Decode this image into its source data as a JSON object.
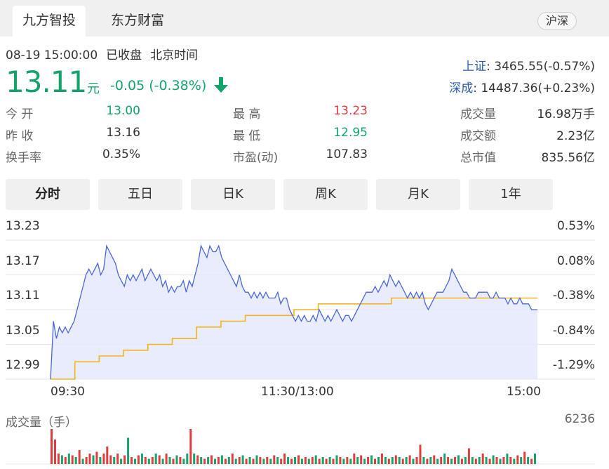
{
  "tabs": [
    {
      "label": "九方智投",
      "active": true
    },
    {
      "label": "东方财富",
      "active": false
    }
  ],
  "market_button": "沪深",
  "meta": {
    "datetime": "08-19 15:00:00",
    "status": "已收盘",
    "timezone": "北京时间"
  },
  "price": {
    "value": "13.11",
    "unit": "元",
    "change": "-0.05 (-0.38%)"
  },
  "indices": [
    {
      "name": "上证",
      "value": ": 3465.55(-0.57%)"
    },
    {
      "name": "深成",
      "value": ": 14487.36(+0.23%)"
    }
  ],
  "quote": {
    "open_label": "今 开",
    "open": "13.00",
    "prev_label": "昨 收",
    "prev": "13.16",
    "turnover_label": "换手率",
    "turnover": "0.35%",
    "high_label": "最 高",
    "high": "13.23",
    "low_label": "最 低",
    "low": "12.95",
    "pe_label": "市盈(动)",
    "pe": "107.83",
    "volume_label": "成交量",
    "volume": "16.98万手",
    "amount_label": "成交额",
    "amount": "2.23亿",
    "mcap_label": "总市值",
    "mcap": "835.56亿"
  },
  "period_tabs": [
    "分时",
    "五日",
    "日K",
    "周K",
    "月K",
    "1年"
  ],
  "active_period": 0,
  "colors": {
    "up": "#e23b3b",
    "down": "#14a36a",
    "price_line": "#4a66d6",
    "avg_line": "#f2b51d",
    "fill": "#e4e9fb"
  },
  "chart_data": {
    "type": "line",
    "y_price_ticks": [
      "13.23",
      "13.17",
      "13.11",
      "13.05",
      "12.99"
    ],
    "y_pct_ticks": [
      "0.53%",
      "0.08%",
      "-0.38%",
      "-0.84%",
      "-1.29%"
    ],
    "ylim": [
      12.99,
      13.23
    ],
    "x_tick_labels": [
      "09:30",
      "11:30/13:00",
      "15:00"
    ],
    "series": [
      {
        "role": "price",
        "values": [
          12.99,
          13.09,
          13.06,
          13.08,
          13.07,
          13.08,
          13.07,
          13.08,
          13.09,
          13.11,
          13.13,
          13.15,
          13.17,
          13.18,
          13.17,
          13.18,
          13.19,
          13.17,
          13.18,
          13.22,
          13.21,
          13.2,
          13.19,
          13.17,
          13.16,
          13.15,
          13.17,
          13.16,
          13.17,
          13.16,
          13.17,
          13.18,
          13.16,
          13.17,
          13.18,
          13.17,
          13.16,
          13.17,
          13.15,
          13.16,
          13.14,
          13.15,
          13.14,
          13.15,
          13.15,
          13.16,
          13.14,
          13.16,
          13.15,
          13.17,
          13.19,
          13.22,
          13.21,
          13.2,
          13.22,
          13.21,
          13.21,
          13.22,
          13.2,
          13.19,
          13.18,
          13.17,
          13.16,
          13.15,
          13.17,
          13.15,
          13.14,
          13.14,
          13.13,
          13.14,
          13.13,
          13.14,
          13.13,
          13.14,
          13.13,
          13.13,
          13.13,
          13.14,
          13.12,
          13.13,
          13.13,
          13.11,
          13.1,
          13.09,
          13.1,
          13.09,
          13.1,
          13.09,
          13.09,
          13.1,
          13.09,
          13.11,
          13.1,
          13.09,
          13.1,
          13.09,
          13.1,
          13.11,
          13.1,
          13.09,
          13.1,
          13.1,
          13.09,
          13.1,
          13.11,
          13.12,
          13.13,
          13.14,
          13.14,
          13.14,
          13.15,
          13.14,
          13.15,
          13.16,
          13.15,
          13.17,
          13.16,
          13.15,
          13.16,
          13.15,
          13.14,
          13.13,
          13.14,
          13.13,
          13.14,
          13.13,
          13.14,
          13.12,
          13.11,
          13.12,
          13.13,
          13.14,
          13.14,
          13.14,
          13.15,
          13.16,
          13.18,
          13.17,
          13.16,
          13.15,
          13.14,
          13.14,
          13.13,
          13.13,
          13.13,
          13.14,
          13.14,
          13.14,
          13.14,
          13.13,
          13.13,
          13.14,
          13.13,
          13.13,
          13.13,
          13.12,
          13.13,
          13.12,
          13.12,
          13.13,
          13.12,
          13.12,
          13.12,
          13.11,
          13.11,
          13.11
        ],
        "count": 240
      },
      {
        "role": "average",
        "values": [
          12.99,
          13.02,
          13.03,
          13.04,
          13.05,
          13.06,
          13.08,
          13.09,
          13.1,
          13.1,
          13.11,
          13.12,
          13.12,
          13.12,
          13.13,
          13.13,
          13.13,
          13.13,
          13.13,
          13.13,
          13.13
        ],
        "count": 240
      }
    ],
    "volume": {
      "ylabel": "成交量（手）",
      "max": 6236,
      "bars": [
        {
          "v": 1.0,
          "c": "up"
        },
        {
          "v": 0.7,
          "c": "up"
        },
        {
          "v": 0.3,
          "c": "up"
        },
        {
          "v": 0.25,
          "c": "down"
        },
        {
          "v": 0.2,
          "c": "up"
        },
        {
          "v": 0.3,
          "c": "down"
        },
        {
          "v": 0.25,
          "c": "up"
        },
        {
          "v": 0.2,
          "c": "down"
        },
        {
          "v": 0.4,
          "c": "up"
        },
        {
          "v": 0.15,
          "c": "down"
        },
        {
          "v": 0.2,
          "c": "up"
        },
        {
          "v": 0.3,
          "c": "up"
        },
        {
          "v": 0.25,
          "c": "down"
        },
        {
          "v": 0.35,
          "c": "up"
        },
        {
          "v": 0.2,
          "c": "down"
        },
        {
          "v": 0.3,
          "c": "up"
        },
        {
          "v": 0.5,
          "c": "up"
        },
        {
          "v": 0.25,
          "c": "up"
        },
        {
          "v": 0.2,
          "c": "down"
        },
        {
          "v": 0.3,
          "c": "up"
        },
        {
          "v": 0.15,
          "c": "down"
        },
        {
          "v": 0.25,
          "c": "up"
        },
        {
          "v": 0.75,
          "c": "down"
        },
        {
          "v": 0.2,
          "c": "up"
        },
        {
          "v": 0.15,
          "c": "down"
        },
        {
          "v": 0.25,
          "c": "up"
        },
        {
          "v": 0.3,
          "c": "down"
        },
        {
          "v": 0.2,
          "c": "up"
        },
        {
          "v": 0.15,
          "c": "down"
        },
        {
          "v": 0.2,
          "c": "up"
        },
        {
          "v": 0.3,
          "c": "down"
        },
        {
          "v": 0.25,
          "c": "up"
        },
        {
          "v": 0.15,
          "c": "down"
        },
        {
          "v": 0.3,
          "c": "up"
        },
        {
          "v": 0.2,
          "c": "down"
        },
        {
          "v": 0.15,
          "c": "up"
        },
        {
          "v": 0.25,
          "c": "down"
        },
        {
          "v": 0.2,
          "c": "up"
        },
        {
          "v": 0.15,
          "c": "down"
        },
        {
          "v": 0.3,
          "c": "down"
        },
        {
          "v": 1.0,
          "c": "up"
        },
        {
          "v": 0.3,
          "c": "down"
        },
        {
          "v": 0.25,
          "c": "up"
        },
        {
          "v": 0.2,
          "c": "down"
        },
        {
          "v": 0.15,
          "c": "up"
        },
        {
          "v": 0.2,
          "c": "down"
        },
        {
          "v": 0.25,
          "c": "up"
        },
        {
          "v": 0.15,
          "c": "down"
        },
        {
          "v": 0.2,
          "c": "up"
        },
        {
          "v": 0.25,
          "c": "down"
        },
        {
          "v": 0.15,
          "c": "up"
        },
        {
          "v": 0.2,
          "c": "down"
        },
        {
          "v": 0.3,
          "c": "up"
        },
        {
          "v": 0.15,
          "c": "down"
        },
        {
          "v": 0.2,
          "c": "up"
        },
        {
          "v": 0.25,
          "c": "down"
        },
        {
          "v": 0.15,
          "c": "up"
        },
        {
          "v": 0.2,
          "c": "down"
        },
        {
          "v": 0.15,
          "c": "up"
        },
        {
          "v": 0.25,
          "c": "down"
        },
        {
          "v": 0.2,
          "c": "up"
        },
        {
          "v": 0.15,
          "c": "down"
        },
        {
          "v": 0.2,
          "c": "up"
        },
        {
          "v": 0.15,
          "c": "down"
        },
        {
          "v": 0.25,
          "c": "up"
        },
        {
          "v": 0.2,
          "c": "down"
        },
        {
          "v": 0.15,
          "c": "up"
        },
        {
          "v": 0.3,
          "c": "up"
        },
        {
          "v": 0.2,
          "c": "down"
        },
        {
          "v": 0.15,
          "c": "up"
        },
        {
          "v": 0.2,
          "c": "down"
        },
        {
          "v": 0.25,
          "c": "up"
        },
        {
          "v": 0.15,
          "c": "down"
        },
        {
          "v": 0.2,
          "c": "up"
        },
        {
          "v": 0.15,
          "c": "down"
        },
        {
          "v": 0.2,
          "c": "up"
        },
        {
          "v": 0.25,
          "c": "down"
        },
        {
          "v": 0.15,
          "c": "up"
        },
        {
          "v": 0.2,
          "c": "down"
        },
        {
          "v": 0.15,
          "c": "up"
        },
        {
          "v": 0.2,
          "c": "down"
        },
        {
          "v": 0.15,
          "c": "up"
        },
        {
          "v": 0.25,
          "c": "down"
        },
        {
          "v": 0.2,
          "c": "up"
        },
        {
          "v": 0.15,
          "c": "down"
        },
        {
          "v": 0.2,
          "c": "up"
        },
        {
          "v": 0.15,
          "c": "down"
        },
        {
          "v": 0.3,
          "c": "up"
        },
        {
          "v": 0.2,
          "c": "down"
        },
        {
          "v": 0.25,
          "c": "up"
        },
        {
          "v": 0.15,
          "c": "down"
        },
        {
          "v": 0.2,
          "c": "up"
        },
        {
          "v": 0.25,
          "c": "down"
        },
        {
          "v": 0.15,
          "c": "up"
        },
        {
          "v": 0.2,
          "c": "down"
        },
        {
          "v": 0.3,
          "c": "up"
        },
        {
          "v": 0.2,
          "c": "down"
        },
        {
          "v": 0.15,
          "c": "up"
        },
        {
          "v": 0.2,
          "c": "down"
        },
        {
          "v": 0.25,
          "c": "up"
        },
        {
          "v": 0.2,
          "c": "down"
        },
        {
          "v": 0.15,
          "c": "up"
        },
        {
          "v": 0.2,
          "c": "down"
        },
        {
          "v": 0.25,
          "c": "up"
        },
        {
          "v": 0.15,
          "c": "down"
        },
        {
          "v": 0.2,
          "c": "up"
        },
        {
          "v": 0.55,
          "c": "up"
        },
        {
          "v": 0.2,
          "c": "down"
        },
        {
          "v": 0.15,
          "c": "up"
        },
        {
          "v": 0.2,
          "c": "down"
        },
        {
          "v": 0.25,
          "c": "up"
        },
        {
          "v": 0.15,
          "c": "down"
        },
        {
          "v": 0.2,
          "c": "up"
        },
        {
          "v": 0.3,
          "c": "down"
        },
        {
          "v": 0.2,
          "c": "up"
        },
        {
          "v": 0.15,
          "c": "down"
        },
        {
          "v": 0.2,
          "c": "up"
        },
        {
          "v": 0.25,
          "c": "down"
        },
        {
          "v": 0.15,
          "c": "up"
        },
        {
          "v": 0.2,
          "c": "down"
        },
        {
          "v": 0.45,
          "c": "up"
        },
        {
          "v": 0.2,
          "c": "down"
        },
        {
          "v": 0.15,
          "c": "up"
        },
        {
          "v": 0.2,
          "c": "down"
        },
        {
          "v": 0.3,
          "c": "up"
        },
        {
          "v": 0.2,
          "c": "down"
        },
        {
          "v": 0.15,
          "c": "up"
        },
        {
          "v": 0.25,
          "c": "down"
        },
        {
          "v": 0.2,
          "c": "up"
        },
        {
          "v": 0.15,
          "c": "down"
        },
        {
          "v": 0.2,
          "c": "up"
        },
        {
          "v": 0.3,
          "c": "down"
        },
        {
          "v": 0.2,
          "c": "up"
        },
        {
          "v": 0.15,
          "c": "down"
        },
        {
          "v": 0.25,
          "c": "up"
        },
        {
          "v": 0.2,
          "c": "down"
        },
        {
          "v": 0.35,
          "c": "up"
        },
        {
          "v": 0.2,
          "c": "down"
        },
        {
          "v": 0.15,
          "c": "up"
        },
        {
          "v": 0.3,
          "c": "down"
        }
      ]
    }
  }
}
